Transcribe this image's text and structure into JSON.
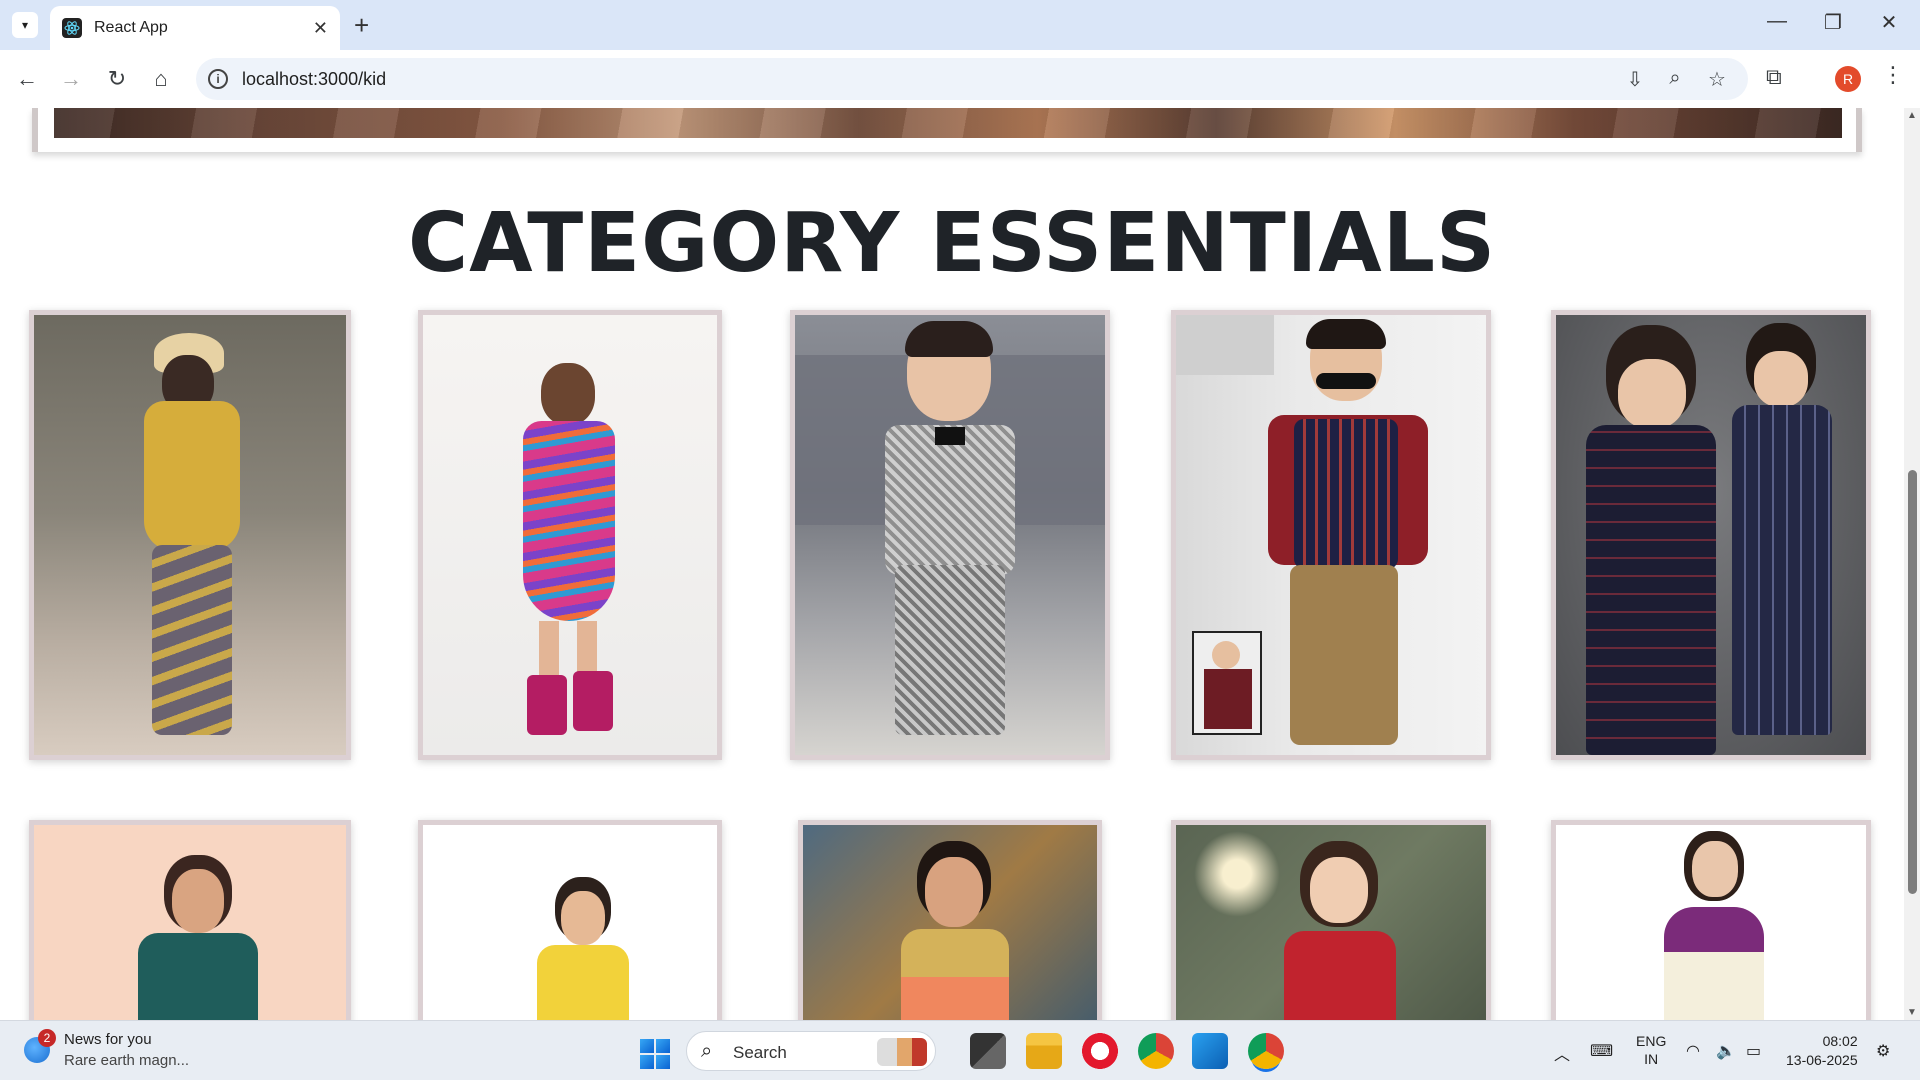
{
  "browser": {
    "tab_title": "React App",
    "url": "localhost:3000/kid",
    "profile_initial": "R"
  },
  "page": {
    "heading": "CATEGORY ESSENTIALS"
  },
  "taskbar": {
    "news_badge": "2",
    "news_title": "News for you",
    "news_subtitle": "Rare earth magn...",
    "search_label": "Search",
    "lang_top": "ENG",
    "lang_bottom": "IN",
    "time": "08:02",
    "date": "13-06-2025"
  }
}
